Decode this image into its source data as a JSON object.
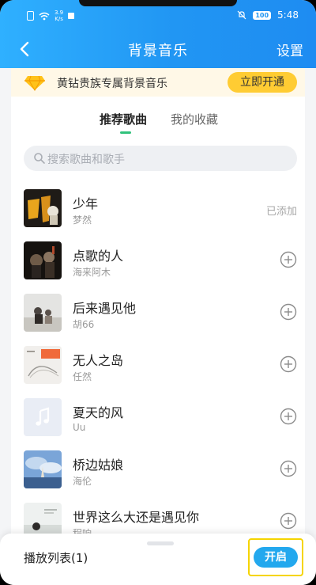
{
  "status_bar": {
    "network_speed": "3.9\nK/s",
    "battery": "100",
    "time": "5:48"
  },
  "nav": {
    "title": "背景音乐",
    "settings": "设置"
  },
  "vip_banner": {
    "text": "黄钻贵族专属背景音乐",
    "button": "立即开通"
  },
  "tabs": [
    {
      "label": "推荐歌曲",
      "active": true
    },
    {
      "label": "我的收藏",
      "active": false
    }
  ],
  "search": {
    "placeholder": "搜索歌曲和歌手"
  },
  "songs": [
    {
      "title": "少年",
      "artist": "梦然",
      "status": "已添加"
    },
    {
      "title": "点歌的人",
      "artist": "海来阿木",
      "status": ""
    },
    {
      "title": "后来遇见他",
      "artist": "胡66",
      "status": ""
    },
    {
      "title": "无人之岛",
      "artist": "任然",
      "status": ""
    },
    {
      "title": "夏天的风",
      "artist": "Uu",
      "status": ""
    },
    {
      "title": "桥边姑娘",
      "artist": "海伦",
      "status": ""
    },
    {
      "title": "世界这么大还是遇见你",
      "artist": "程响",
      "status": ""
    }
  ],
  "bottom_bar": {
    "playlist_label": "播放列表(1)",
    "open_button": "开启"
  },
  "colors": {
    "accent_blue": "#23a8ee",
    "tab_indicator": "#31c27c",
    "vip_button": "#ffcc33"
  }
}
